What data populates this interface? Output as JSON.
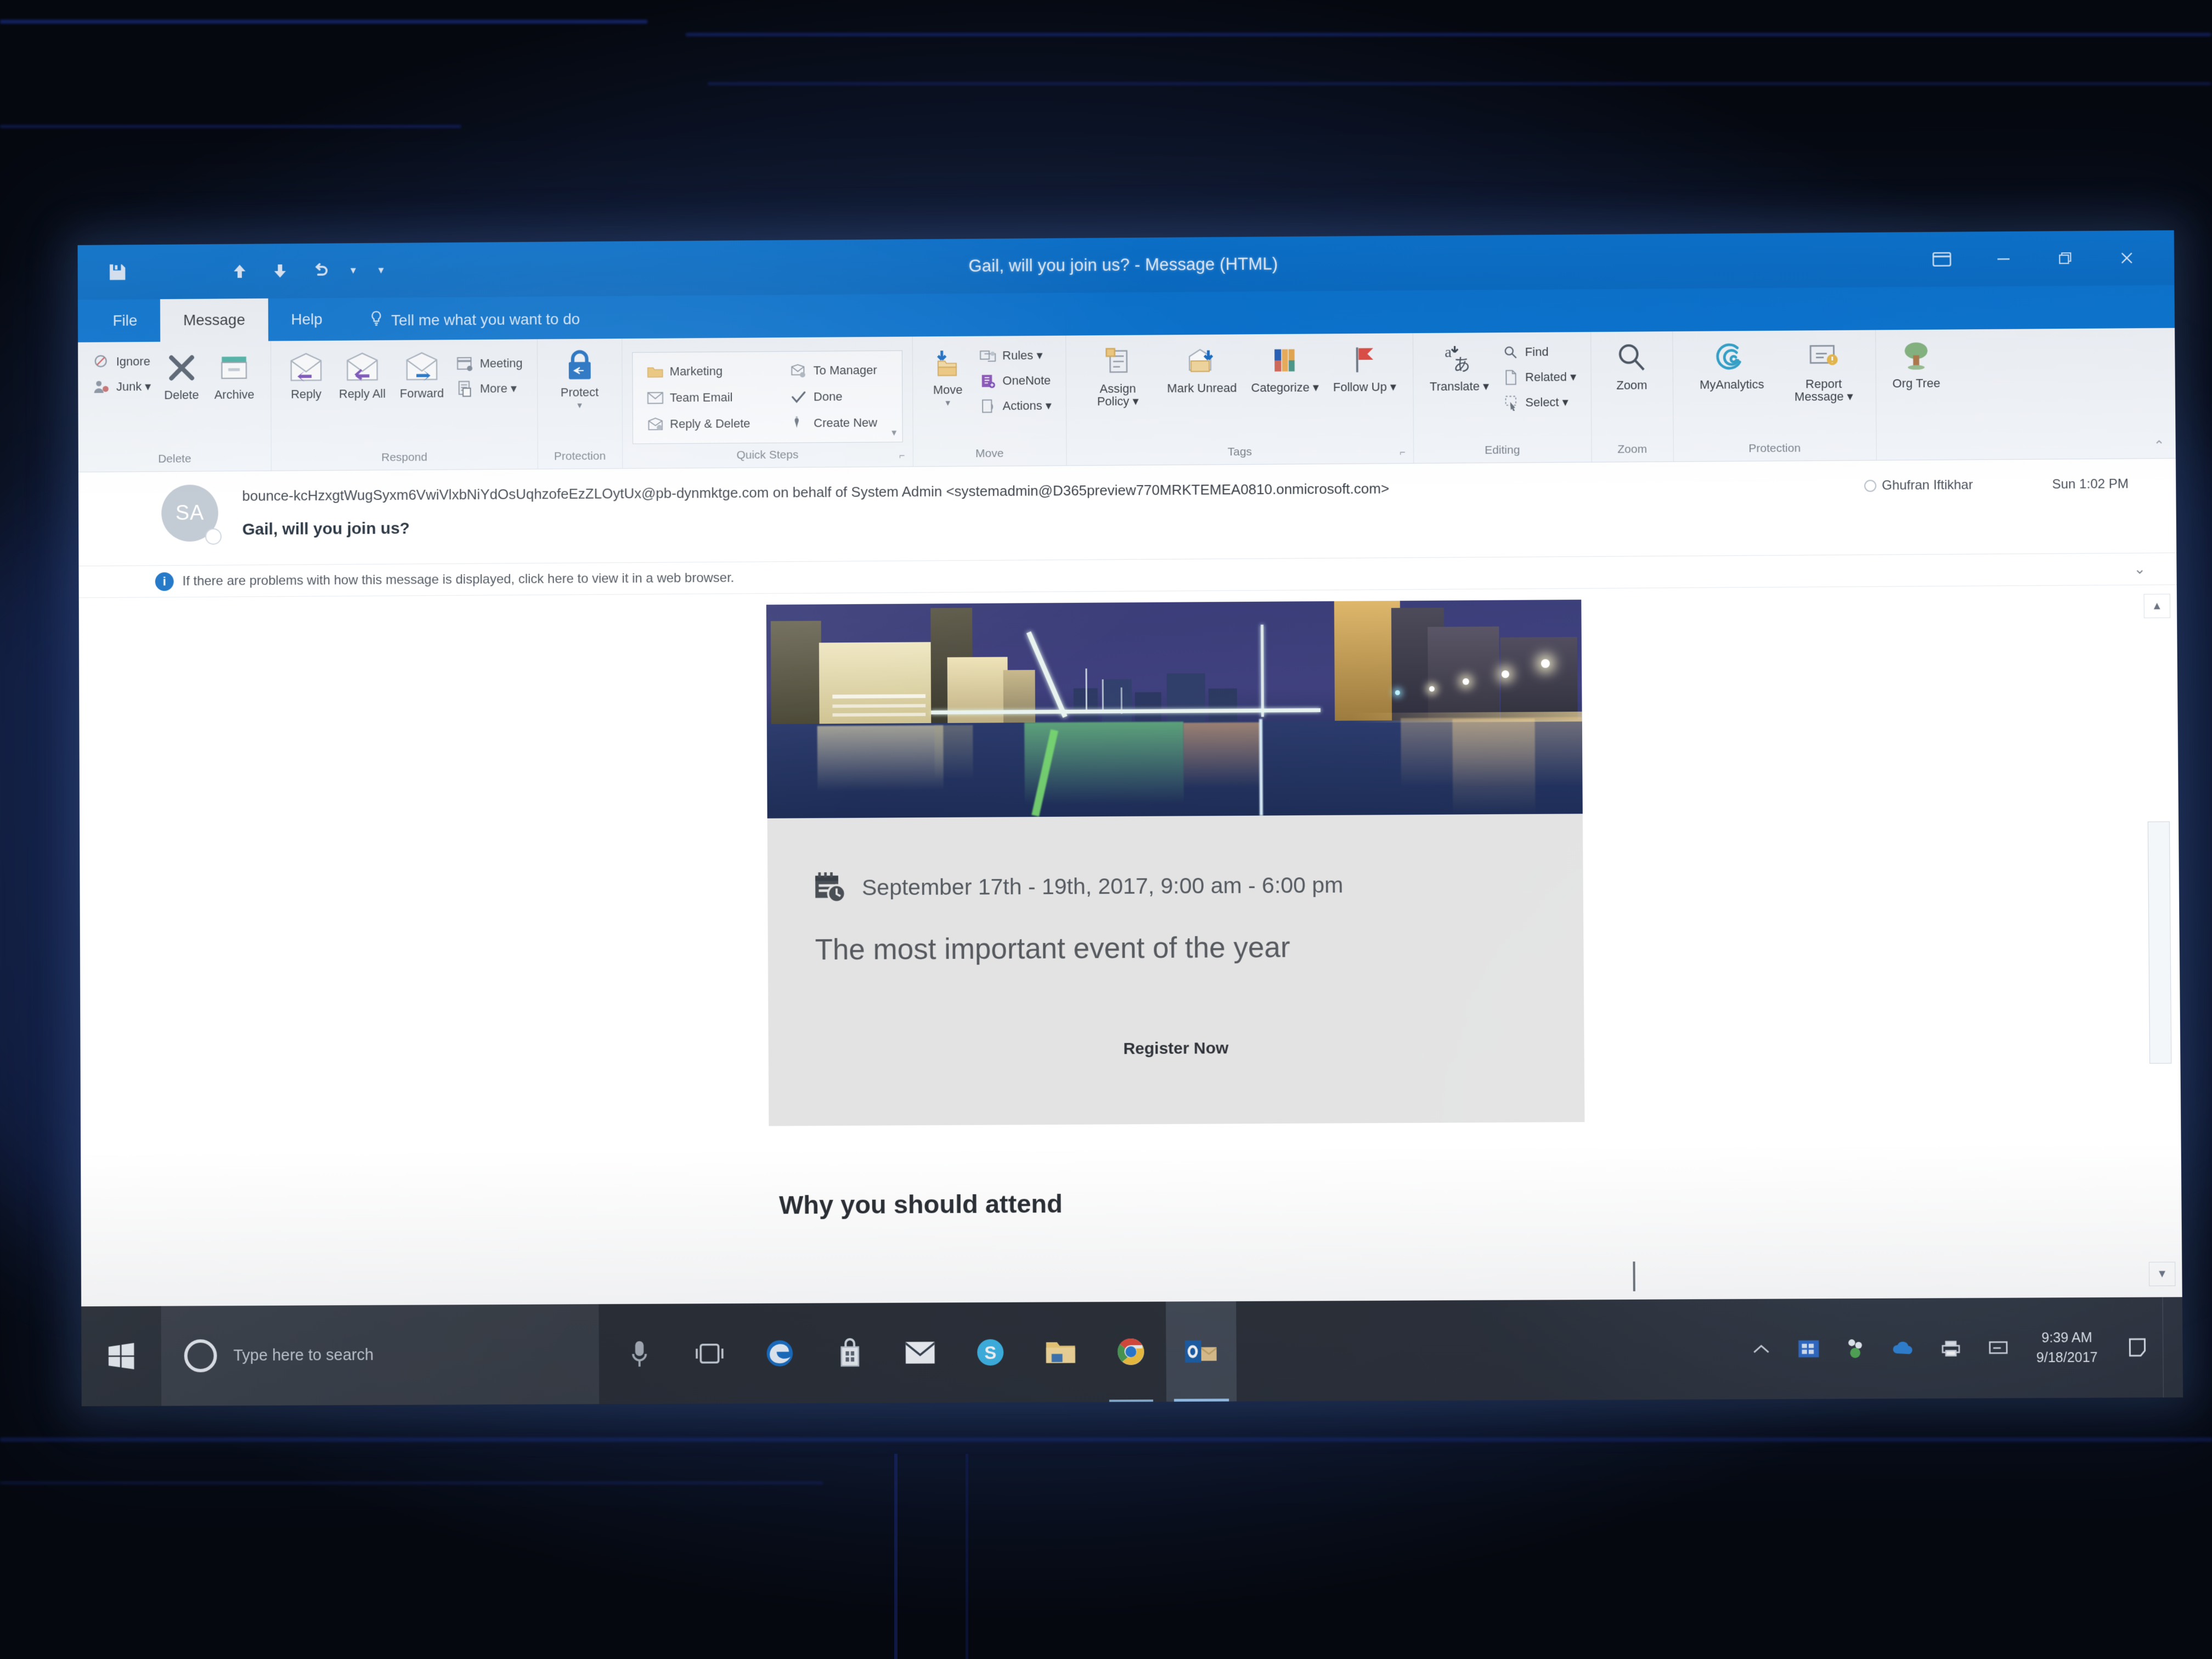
{
  "window": {
    "title": "Gail, will you join us?  -  Message (HTML)",
    "quick_access": [
      {
        "name": "save",
        "glyph": "Ὃe"
      },
      {
        "name": "previous-item",
        "glyph": "↑"
      },
      {
        "name": "next-item",
        "glyph": "↓"
      },
      {
        "name": "undo",
        "glyph": "↶"
      },
      {
        "name": "customize",
        "glyph": "▾"
      }
    ],
    "controls": [
      {
        "name": "ribbon-display-options",
        "label": "Ribbon Display Options"
      },
      {
        "name": "minimize",
        "label": "Minimize"
      },
      {
        "name": "restore",
        "label": "Restore Down"
      },
      {
        "name": "close",
        "label": "Close"
      }
    ]
  },
  "ribbon": {
    "tabs": [
      {
        "label": "File",
        "active": false
      },
      {
        "label": "Message",
        "active": true
      },
      {
        "label": "Help",
        "active": false
      }
    ],
    "tell_me": "Tell me what you want to do",
    "collapse_label": "Collapse the Ribbon",
    "groups": [
      {
        "label": "Delete",
        "small_items": [
          {
            "label": "Ignore",
            "icon": "ignore-icon"
          },
          {
            "label": "Junk ▾",
            "icon": "junk-icon"
          }
        ],
        "big_items": [
          {
            "label": "Delete",
            "icon": "delete-x-icon"
          },
          {
            "label": "Archive",
            "icon": "archive-icon"
          }
        ]
      },
      {
        "label": "Respond",
        "big_items": [
          {
            "label": "Reply",
            "icon": "reply-icon"
          },
          {
            "label": "Reply All",
            "icon": "reply-all-icon"
          },
          {
            "label": "Forward",
            "icon": "forward-icon"
          }
        ],
        "small_items": [
          {
            "label": "Meeting",
            "icon": "meeting-icon"
          },
          {
            "label": "More ▾",
            "icon": "more-icon"
          }
        ]
      },
      {
        "label": "Protection",
        "big_items": [
          {
            "label": "Protect",
            "icon": "protect-lock-icon",
            "has_dropdown": true
          }
        ]
      },
      {
        "label": "Quick Steps",
        "has_dialog_launcher": true,
        "quick_steps_col1": [
          {
            "label": "Marketing",
            "icon": "folder-icon"
          },
          {
            "label": "Team Email",
            "icon": "team-email-icon"
          },
          {
            "label": "Reply & Delete",
            "icon": "reply-delete-icon"
          }
        ],
        "quick_steps_col2": [
          {
            "label": "To Manager",
            "icon": "to-manager-icon"
          },
          {
            "label": "Done",
            "icon": "done-check-icon"
          },
          {
            "label": "Create New",
            "icon": "create-new-icon"
          }
        ]
      },
      {
        "label": "Move",
        "big_items": [
          {
            "label": "Move",
            "icon": "move-folder-icon",
            "has_dropdown": true
          }
        ],
        "small_items": [
          {
            "label": "Rules ▾",
            "icon": "rules-icon"
          },
          {
            "label": "OneNote",
            "icon": "onenote-icon"
          },
          {
            "label": "Actions ▾",
            "icon": "actions-icon"
          }
        ]
      },
      {
        "label": "Tags",
        "has_dialog_launcher": true,
        "big_items": [
          {
            "label": "Assign Policy ▾",
            "icon": "assign-policy-icon"
          },
          {
            "label": "Mark Unread",
            "icon": "mark-unread-icon"
          },
          {
            "label": "Categorize ▾",
            "icon": "categorize-icon"
          },
          {
            "label": "Follow Up ▾",
            "icon": "follow-up-flag-icon"
          }
        ]
      },
      {
        "label": "Editing",
        "big_items": [
          {
            "label": "Translate ▾",
            "icon": "translate-icon"
          }
        ],
        "small_items": [
          {
            "label": "Find",
            "icon": "find-icon"
          },
          {
            "label": "Related ▾",
            "icon": "related-icon"
          },
          {
            "label": "Select ▾",
            "icon": "select-icon"
          }
        ]
      },
      {
        "label": "Zoom",
        "big_items": [
          {
            "label": "Zoom",
            "icon": "zoom-magnifier-icon"
          }
        ]
      },
      {
        "label": "Protection",
        "big_items": [
          {
            "label": "MyAnalytics",
            "icon": "myanalytics-icon"
          },
          {
            "label": "Report Message ▾",
            "icon": "report-message-icon"
          }
        ]
      },
      {
        "label": "",
        "big_items": [
          {
            "label": "Org Tree",
            "icon": "org-tree-icon"
          }
        ]
      }
    ]
  },
  "message": {
    "avatar_initials": "SA",
    "from": "bounce-kcHzxgtWugSyxm6VwiVlxbNiYdOsUqhzofeEzZLOytUx@pb-dynmktge.com on behalf of System Admin <systemadmin@D365preview770MRKTEMEA0810.onmicrosoft.com>",
    "subject": "Gail, will you join us?",
    "to": "Ghufran Iftikhar",
    "received": "Sun 1:02 PM",
    "info_bar": "If there are problems with how this message is displayed, click here to view it in a web browser."
  },
  "email_body": {
    "hero_alt": "Night cityscape with waterfront and white cable-stayed bridge",
    "date_line": "September 17th - 19th, 2017, 9:00 am - 6:00 pm",
    "headline": "The most important event of the year",
    "cta": "Register Now",
    "section_heading": "Why you should attend"
  },
  "taskbar": {
    "start_label": "Start",
    "search_placeholder": "Type here to search",
    "apps": [
      {
        "name": "cortana-mic-icon",
        "label": "Cortana"
      },
      {
        "name": "task-view-icon",
        "label": "Task View"
      },
      {
        "name": "edge-icon",
        "label": "Microsoft Edge"
      },
      {
        "name": "store-icon",
        "label": "Microsoft Store"
      },
      {
        "name": "mail-icon",
        "label": "Mail"
      },
      {
        "name": "skype-icon",
        "label": "Skype"
      },
      {
        "name": "file-explorer-icon",
        "label": "File Explorer"
      },
      {
        "name": "chrome-icon",
        "label": "Google Chrome"
      },
      {
        "name": "outlook-icon",
        "label": "Microsoft Outlook"
      }
    ],
    "tray": [
      {
        "name": "show-hidden-icons-icon",
        "label": "Show hidden icons"
      },
      {
        "name": "onedrive-business-icon",
        "label": "OneDrive for Business"
      },
      {
        "name": "skype-business-icon",
        "label": "Skype for Business"
      },
      {
        "name": "onedrive-icon",
        "label": "OneDrive"
      },
      {
        "name": "printer-icon",
        "label": "Printer"
      },
      {
        "name": "network-icon",
        "label": "Network"
      }
    ],
    "clock_time": "9:39 AM",
    "clock_date": "9/18/2017",
    "action_center_label": "Action Center"
  },
  "colors": {
    "title_bar": "#0b74d0",
    "ribbon_bg": "#f2f5f9",
    "card_bg": "#e3e3e3",
    "taskbar": "#2b2f36",
    "accent": "#1b72c4"
  }
}
